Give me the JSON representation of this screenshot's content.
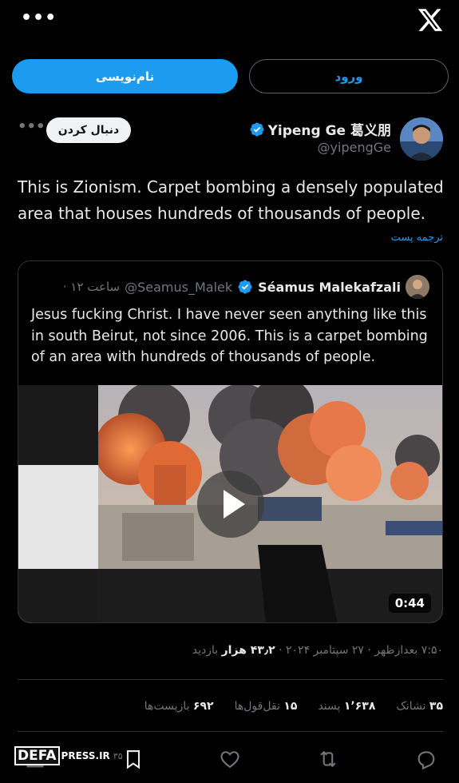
{
  "top": {
    "more_label": "•••"
  },
  "auth": {
    "signup_label": "نام‌نویسی",
    "login_label": "ورود"
  },
  "author": {
    "name": "Yipeng Ge 葛义朋",
    "handle": "@yipengGe",
    "follow_label": "دنبال کردن",
    "more_label": "•••"
  },
  "tweet": {
    "text": "This is Zionism. Carpet bombing a densely populated area that houses hundreds of thousands of people.",
    "translate_label": "ترجمه پست"
  },
  "quote": {
    "name": "Séamus Malekafzali",
    "handle": "@Seamus_Malek",
    "time": "· ۱۲ ساعت",
    "text": "Jesus fucking Christ. I have never seen anything like this in south Beirut, not since 2006. This is a carpet bombing of an area with hundreds of thousands of people.",
    "video_duration": "0:44"
  },
  "meta": {
    "timestamp": "۷:۵۰ بعدازظهر · ۲۷ سپتامبر ۲۰۲۴ · ",
    "views_count": "۴۳٫۲ هزار",
    "views_label": " بازدید"
  },
  "stats": {
    "reposts_count": "۶۹۲",
    "reposts_label": " بازپست‌ها",
    "quotes_count": "۱۵",
    "quotes_label": " نقل‌قول‌ها",
    "likes_count": "۱٬۶۳۸",
    "likes_label": " پسند",
    "bookmarks_count": "۳۵",
    "bookmarks_label": " نشانک"
  },
  "actions": {
    "bookmark_count": "۳۵"
  },
  "watermark": {
    "brand": "DEFA",
    "site": "PRESS.IR"
  },
  "colors": {
    "accent": "#1d9bf0",
    "background": "#000000",
    "text": "#e7e9ea",
    "muted": "#71767b",
    "border": "#2f3336"
  },
  "icons": [
    "more-icon",
    "x-logo-icon",
    "verified-icon",
    "play-icon",
    "reply-icon",
    "repost-icon",
    "like-icon",
    "bookmark-icon",
    "share-icon"
  ]
}
